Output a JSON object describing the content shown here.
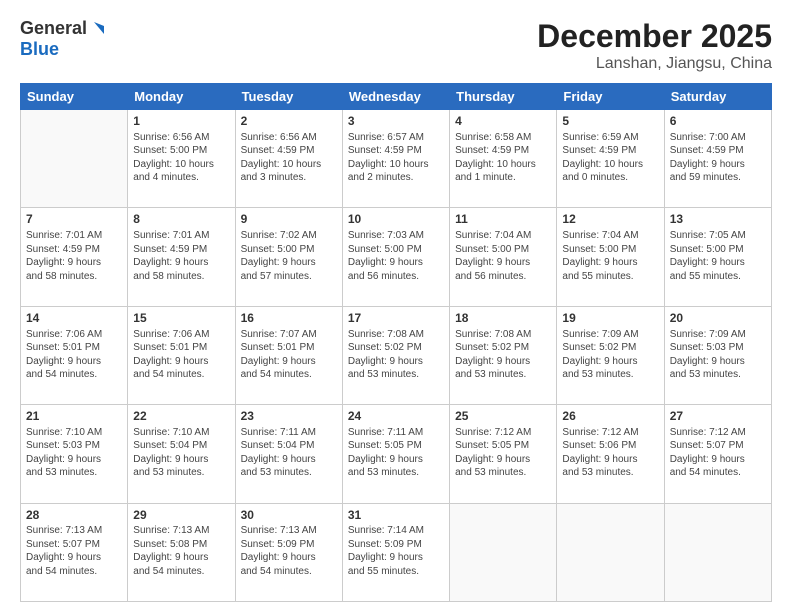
{
  "logo": {
    "general": "General",
    "blue": "Blue"
  },
  "header": {
    "month": "December 2025",
    "location": "Lanshan, Jiangsu, China"
  },
  "weekdays": [
    "Sunday",
    "Monday",
    "Tuesday",
    "Wednesday",
    "Thursday",
    "Friday",
    "Saturday"
  ],
  "weeks": [
    [
      {
        "day": "",
        "info": ""
      },
      {
        "day": "1",
        "info": "Sunrise: 6:56 AM\nSunset: 5:00 PM\nDaylight: 10 hours\nand 4 minutes."
      },
      {
        "day": "2",
        "info": "Sunrise: 6:56 AM\nSunset: 4:59 PM\nDaylight: 10 hours\nand 3 minutes."
      },
      {
        "day": "3",
        "info": "Sunrise: 6:57 AM\nSunset: 4:59 PM\nDaylight: 10 hours\nand 2 minutes."
      },
      {
        "day": "4",
        "info": "Sunrise: 6:58 AM\nSunset: 4:59 PM\nDaylight: 10 hours\nand 1 minute."
      },
      {
        "day": "5",
        "info": "Sunrise: 6:59 AM\nSunset: 4:59 PM\nDaylight: 10 hours\nand 0 minutes."
      },
      {
        "day": "6",
        "info": "Sunrise: 7:00 AM\nSunset: 4:59 PM\nDaylight: 9 hours\nand 59 minutes."
      }
    ],
    [
      {
        "day": "7",
        "info": "Sunrise: 7:01 AM\nSunset: 4:59 PM\nDaylight: 9 hours\nand 58 minutes."
      },
      {
        "day": "8",
        "info": "Sunrise: 7:01 AM\nSunset: 4:59 PM\nDaylight: 9 hours\nand 58 minutes."
      },
      {
        "day": "9",
        "info": "Sunrise: 7:02 AM\nSunset: 5:00 PM\nDaylight: 9 hours\nand 57 minutes."
      },
      {
        "day": "10",
        "info": "Sunrise: 7:03 AM\nSunset: 5:00 PM\nDaylight: 9 hours\nand 56 minutes."
      },
      {
        "day": "11",
        "info": "Sunrise: 7:04 AM\nSunset: 5:00 PM\nDaylight: 9 hours\nand 56 minutes."
      },
      {
        "day": "12",
        "info": "Sunrise: 7:04 AM\nSunset: 5:00 PM\nDaylight: 9 hours\nand 55 minutes."
      },
      {
        "day": "13",
        "info": "Sunrise: 7:05 AM\nSunset: 5:00 PM\nDaylight: 9 hours\nand 55 minutes."
      }
    ],
    [
      {
        "day": "14",
        "info": "Sunrise: 7:06 AM\nSunset: 5:01 PM\nDaylight: 9 hours\nand 54 minutes."
      },
      {
        "day": "15",
        "info": "Sunrise: 7:06 AM\nSunset: 5:01 PM\nDaylight: 9 hours\nand 54 minutes."
      },
      {
        "day": "16",
        "info": "Sunrise: 7:07 AM\nSunset: 5:01 PM\nDaylight: 9 hours\nand 54 minutes."
      },
      {
        "day": "17",
        "info": "Sunrise: 7:08 AM\nSunset: 5:02 PM\nDaylight: 9 hours\nand 53 minutes."
      },
      {
        "day": "18",
        "info": "Sunrise: 7:08 AM\nSunset: 5:02 PM\nDaylight: 9 hours\nand 53 minutes."
      },
      {
        "day": "19",
        "info": "Sunrise: 7:09 AM\nSunset: 5:02 PM\nDaylight: 9 hours\nand 53 minutes."
      },
      {
        "day": "20",
        "info": "Sunrise: 7:09 AM\nSunset: 5:03 PM\nDaylight: 9 hours\nand 53 minutes."
      }
    ],
    [
      {
        "day": "21",
        "info": "Sunrise: 7:10 AM\nSunset: 5:03 PM\nDaylight: 9 hours\nand 53 minutes."
      },
      {
        "day": "22",
        "info": "Sunrise: 7:10 AM\nSunset: 5:04 PM\nDaylight: 9 hours\nand 53 minutes."
      },
      {
        "day": "23",
        "info": "Sunrise: 7:11 AM\nSunset: 5:04 PM\nDaylight: 9 hours\nand 53 minutes."
      },
      {
        "day": "24",
        "info": "Sunrise: 7:11 AM\nSunset: 5:05 PM\nDaylight: 9 hours\nand 53 minutes."
      },
      {
        "day": "25",
        "info": "Sunrise: 7:12 AM\nSunset: 5:05 PM\nDaylight: 9 hours\nand 53 minutes."
      },
      {
        "day": "26",
        "info": "Sunrise: 7:12 AM\nSunset: 5:06 PM\nDaylight: 9 hours\nand 53 minutes."
      },
      {
        "day": "27",
        "info": "Sunrise: 7:12 AM\nSunset: 5:07 PM\nDaylight: 9 hours\nand 54 minutes."
      }
    ],
    [
      {
        "day": "28",
        "info": "Sunrise: 7:13 AM\nSunset: 5:07 PM\nDaylight: 9 hours\nand 54 minutes."
      },
      {
        "day": "29",
        "info": "Sunrise: 7:13 AM\nSunset: 5:08 PM\nDaylight: 9 hours\nand 54 minutes."
      },
      {
        "day": "30",
        "info": "Sunrise: 7:13 AM\nSunset: 5:09 PM\nDaylight: 9 hours\nand 54 minutes."
      },
      {
        "day": "31",
        "info": "Sunrise: 7:14 AM\nSunset: 5:09 PM\nDaylight: 9 hours\nand 55 minutes."
      },
      {
        "day": "",
        "info": ""
      },
      {
        "day": "",
        "info": ""
      },
      {
        "day": "",
        "info": ""
      }
    ]
  ]
}
